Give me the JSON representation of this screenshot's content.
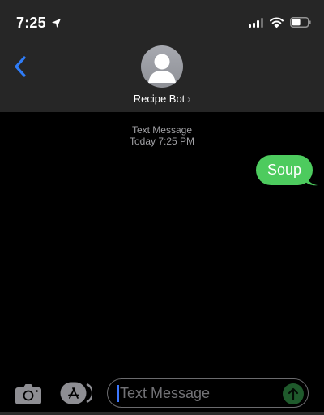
{
  "status_bar": {
    "time": "7:25",
    "location_icon": "location-arrow-icon",
    "signal_icon": "cellular-signal-icon",
    "wifi_icon": "wifi-icon",
    "battery_icon": "battery-icon"
  },
  "header": {
    "back_icon": "chevron-left-icon",
    "contact_name": "Recipe Bot",
    "contact_chevron": "›",
    "avatar_icon": "person-silhouette-icon"
  },
  "conversation": {
    "service_label": "Text Message",
    "timestamp": "Today 7:25 PM",
    "messages": [
      {
        "direction": "outgoing",
        "text": "Soup"
      }
    ]
  },
  "composer": {
    "camera_icon": "camera-icon",
    "apps_icon": "app-store-icon",
    "placeholder": "Text Message",
    "send_icon": "arrow-up-icon"
  },
  "colors": {
    "header_bg": "#262626",
    "bubble_outgoing": "#4dcb5e",
    "accent_blue": "#3d78ff",
    "send_button": "#1f5a2c"
  }
}
